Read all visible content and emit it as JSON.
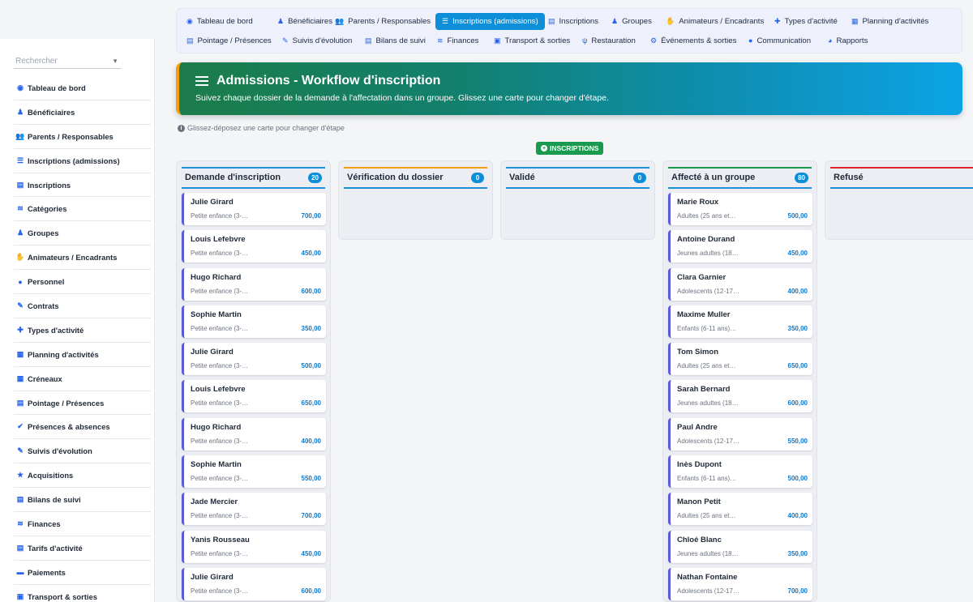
{
  "search": {
    "placeholder": "Rechercher"
  },
  "sidebar": {
    "items": [
      {
        "label": "Tableau de bord",
        "icon": "dashboard-icon",
        "glyph": "◉"
      },
      {
        "label": "Bénéficiaires",
        "icon": "child-icon",
        "glyph": "♟"
      },
      {
        "label": "Parents / Responsables",
        "icon": "users-icon",
        "glyph": "👥"
      },
      {
        "label": "Inscriptions (admissions)",
        "icon": "list-icon",
        "glyph": "☰"
      },
      {
        "label": "Inscriptions",
        "icon": "clipboard-icon",
        "glyph": "▤"
      },
      {
        "label": "Catégories",
        "icon": "layers-icon",
        "glyph": "≋"
      },
      {
        "label": "Groupes",
        "icon": "child-icon",
        "glyph": "♟"
      },
      {
        "label": "Animateurs / Encadrants",
        "icon": "handshake-icon",
        "glyph": "✋"
      },
      {
        "label": "Personnel",
        "icon": "user-icon",
        "glyph": "●"
      },
      {
        "label": "Contrats",
        "icon": "contract-icon",
        "glyph": "✎"
      },
      {
        "label": "Types d'activité",
        "icon": "puzzle-icon",
        "glyph": "✚"
      },
      {
        "label": "Planning d'activités",
        "icon": "calendar-icon",
        "glyph": "▦"
      },
      {
        "label": "Créneaux",
        "icon": "calendar-icon",
        "glyph": "▦"
      },
      {
        "label": "Pointage / Présences",
        "icon": "clipboard-icon",
        "glyph": "▤"
      },
      {
        "label": "Présences & absences",
        "icon": "user-check-icon",
        "glyph": "✔"
      },
      {
        "label": "Suivis d'évolution",
        "icon": "pen-icon",
        "glyph": "✎"
      },
      {
        "label": "Acquisitions",
        "icon": "star-icon",
        "glyph": "★"
      },
      {
        "label": "Bilans de suivi",
        "icon": "file-icon",
        "glyph": "▤"
      },
      {
        "label": "Finances",
        "icon": "money-icon",
        "glyph": "≋"
      },
      {
        "label": "Tarifs d'activité",
        "icon": "file-icon",
        "glyph": "▤"
      },
      {
        "label": "Paiements",
        "icon": "money-icon",
        "glyph": "▬"
      },
      {
        "label": "Transport & sorties",
        "icon": "bus-icon",
        "glyph": "▣"
      }
    ]
  },
  "topnav": {
    "row1": [
      {
        "label": "Tableau de bord",
        "icon": "dashboard-icon",
        "glyph": "◉",
        "active": false
      },
      {
        "label": "Bénéficiaires",
        "icon": "child-icon",
        "glyph": "♟",
        "active": false
      },
      {
        "label": "Parents / Responsables",
        "icon": "users-icon",
        "glyph": "👥",
        "active": false
      },
      {
        "label": "Inscriptions (admissions)",
        "icon": "list-icon",
        "glyph": "☰",
        "active": true
      },
      {
        "label": "Inscriptions",
        "icon": "clipboard-icon",
        "glyph": "▤",
        "active": false
      },
      {
        "label": "Groupes",
        "icon": "child-icon",
        "glyph": "♟",
        "active": false
      },
      {
        "label": "Animateurs / Encadrants",
        "icon": "handshake-icon",
        "glyph": "✋",
        "active": false
      },
      {
        "label": "Types d'activité",
        "icon": "puzzle-icon",
        "glyph": "✚",
        "active": false
      },
      {
        "label": "Planning d'activités",
        "icon": "calendar-icon",
        "glyph": "▦",
        "active": false
      }
    ],
    "row2": [
      {
        "label": "Pointage / Présences",
        "icon": "clipboard-icon",
        "glyph": "▤",
        "active": false
      },
      {
        "label": "Suivis d'évolution",
        "icon": "pen-icon",
        "glyph": "✎",
        "active": false
      },
      {
        "label": "Bilans de suivi",
        "icon": "file-icon",
        "glyph": "▤",
        "active": false
      },
      {
        "label": "Finances",
        "icon": "money-icon",
        "glyph": "≋",
        "active": false
      },
      {
        "label": "Transport & sorties",
        "icon": "bus-icon",
        "glyph": "▣",
        "active": false
      },
      {
        "label": "Restauration",
        "icon": "utensils-icon",
        "glyph": "ψ",
        "active": false
      },
      {
        "label": "Événements & sorties",
        "icon": "gear-icon",
        "glyph": "⚙",
        "active": false
      },
      {
        "label": "Communication",
        "icon": "chat-icon",
        "glyph": "●",
        "active": false
      },
      {
        "label": "Rapports",
        "icon": "pie-chart-icon",
        "glyph": "◕",
        "active": false
      }
    ]
  },
  "banner": {
    "title": "Admissions - Workflow d'inscription",
    "subtitle": "Suivez chaque dossier de la demande à l'affectation dans un groupe. Glissez une carte pour changer d'étape."
  },
  "hint": "Glissez-déposez une carte pour changer d'étape",
  "badge": "INSCRIPTIONS",
  "colors": {
    "accent": "#0d8ed9",
    "col_demande": "#1f8fd9",
    "col_verification": "#f59e0b",
    "col_valide": "#1f8fd9",
    "col_affecte": "#1a9a4e",
    "col_refuse": "#dc2626",
    "card_border": "#5b5bd6"
  },
  "columns": [
    {
      "title": "Demande d'inscription",
      "count": "20",
      "color": "#1f8fd9",
      "cards": [
        {
          "name": "Julie Girard",
          "category": "Petite enfance (3-…",
          "amount": "700,00"
        },
        {
          "name": "Louis Lefebvre",
          "category": "Petite enfance (3-…",
          "amount": "450,00"
        },
        {
          "name": "Hugo Richard",
          "category": "Petite enfance (3-…",
          "amount": "600,00"
        },
        {
          "name": "Sophie Martin",
          "category": "Petite enfance (3-…",
          "amount": "350,00"
        },
        {
          "name": "Julie Girard",
          "category": "Petite enfance (3-…",
          "amount": "500,00"
        },
        {
          "name": "Louis Lefebvre",
          "category": "Petite enfance (3-…",
          "amount": "650,00"
        },
        {
          "name": "Hugo Richard",
          "category": "Petite enfance (3-…",
          "amount": "400,00"
        },
        {
          "name": "Sophie Martin",
          "category": "Petite enfance (3-…",
          "amount": "550,00"
        },
        {
          "name": "Jade Mercier",
          "category": "Petite enfance (3-…",
          "amount": "700,00"
        },
        {
          "name": "Yanis Rousseau",
          "category": "Petite enfance (3-…",
          "amount": "450,00"
        },
        {
          "name": "Julie Girard",
          "category": "Petite enfance (3-…",
          "amount": "600,00"
        }
      ]
    },
    {
      "title": "Vérification du dossier",
      "count": "0",
      "color": "#f59e0b",
      "cards": []
    },
    {
      "title": "Validé",
      "count": "0",
      "color": "#1f8fd9",
      "cards": []
    },
    {
      "title": "Affecté à un groupe",
      "count": "80",
      "color": "#1a9a4e",
      "cards": [
        {
          "name": "Marie Roux",
          "category": "Adultes (25 ans et…",
          "amount": "500,00"
        },
        {
          "name": "Antoine Durand",
          "category": "Jeunes adultes (18…",
          "amount": "450,00"
        },
        {
          "name": "Clara Garnier",
          "category": "Adolescents (12-17…",
          "amount": "400,00"
        },
        {
          "name": "Maxime Muller",
          "category": "Enfants (6-11 ans)…",
          "amount": "350,00"
        },
        {
          "name": "Tom Simon",
          "category": "Adultes (25 ans et…",
          "amount": "650,00"
        },
        {
          "name": "Sarah Bernard",
          "category": "Jeunes adultes (18…",
          "amount": "600,00"
        },
        {
          "name": "Paul Andre",
          "category": "Adolescents (12-17…",
          "amount": "550,00"
        },
        {
          "name": "Inès Dupont",
          "category": "Enfants (6-11 ans)…",
          "amount": "500,00"
        },
        {
          "name": "Manon Petit",
          "category": "Adultes (25 ans et…",
          "amount": "400,00"
        },
        {
          "name": "Chloé Blanc",
          "category": "Jeunes adultes (18…",
          "amount": "350,00"
        },
        {
          "name": "Nathan Fontaine",
          "category": "Adolescents (12-17…",
          "amount": "700,00"
        }
      ]
    },
    {
      "title": "Refusé",
      "count": "",
      "color": "#dc2626",
      "cards": []
    }
  ]
}
